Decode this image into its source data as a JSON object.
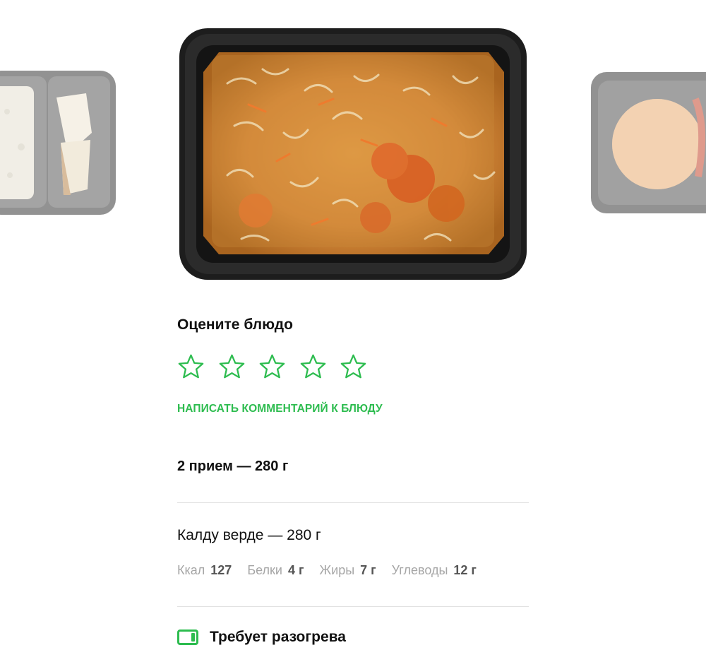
{
  "carousel": {
    "items": [
      {
        "name": "prev-dish",
        "icon": "rice-chicken-container"
      },
      {
        "name": "current-dish",
        "icon": "cabbage-soup-container"
      },
      {
        "name": "next-dish",
        "icon": "burger-container"
      }
    ]
  },
  "rating": {
    "title": "Оцените блюдо",
    "stars": 5,
    "current": 0,
    "star_color": "#2dbc4f"
  },
  "comment_link": "НАПИСАТЬ КОММЕНТАРИЙ К БЛЮДУ",
  "meal": {
    "title": "2 прием — 280 г"
  },
  "dish": {
    "name": "Калду верде — 280 г",
    "nutrition": [
      {
        "label": "Ккал",
        "value": "127"
      },
      {
        "label": "Белки",
        "value": "4 г"
      },
      {
        "label": "Жиры",
        "value": "7 г"
      },
      {
        "label": "Углеводы",
        "value": "12 г"
      }
    ]
  },
  "heating": {
    "icon": "microwave-icon",
    "text": "Требует разогрева"
  },
  "colors": {
    "accent": "#2dbc4f",
    "muted": "#a6a6a6",
    "divider": "#e2e2e2"
  }
}
